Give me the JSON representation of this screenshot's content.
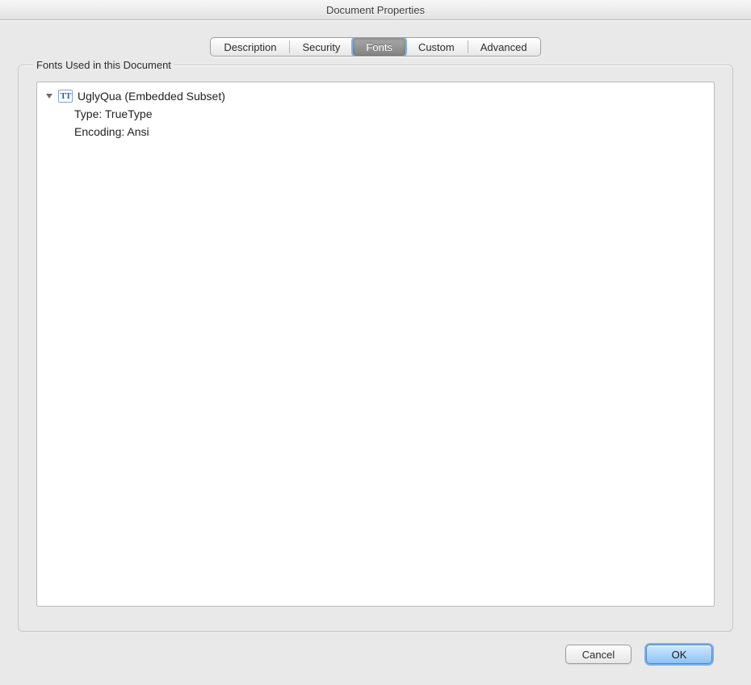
{
  "window_title": "Document Properties",
  "tabs": {
    "description": "Description",
    "security": "Security",
    "fonts": "Fonts",
    "custom": "Custom",
    "advanced": "Advanced",
    "selected": "fonts"
  },
  "panel_label": "Fonts Used in this Document",
  "fonts": [
    {
      "name": "UglyQua (Embedded Subset)",
      "type_label": "Type: TrueType",
      "encoding_label": "Encoding: Ansi"
    }
  ],
  "tt_glyph": "TT",
  "buttons": {
    "cancel": "Cancel",
    "ok": "OK"
  }
}
